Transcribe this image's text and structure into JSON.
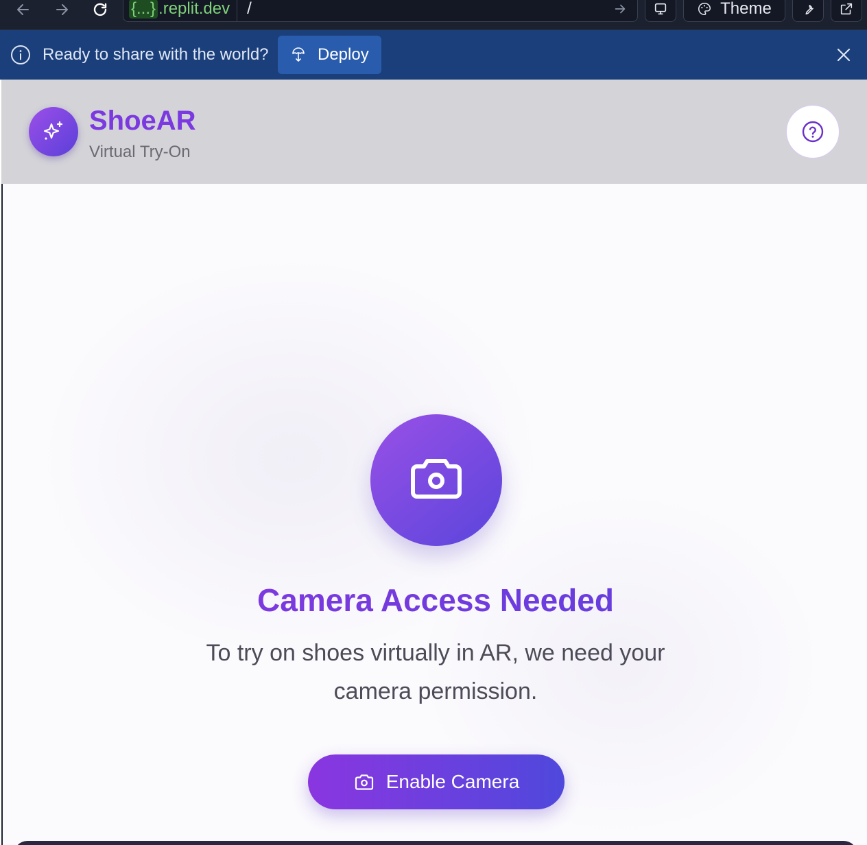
{
  "browser": {
    "url_prefix": "{...}",
    "url_domain": ".replit.dev",
    "url_path": "/",
    "theme_label": "Theme"
  },
  "banner": {
    "message": "Ready to share with the world?",
    "deploy_label": "Deploy"
  },
  "header": {
    "brand_name": "ShoeAR",
    "brand_subtitle": "Virtual Try-On"
  },
  "main": {
    "headline": "Camera Access Needed",
    "description": "To try on shoes virtually in AR, we need your camera permission.",
    "enable_label": "Enable Camera"
  },
  "colors": {
    "accent": "#7a3ae0",
    "banner_bg": "#1b3f7a",
    "deploy_button": "#2a5cae"
  },
  "icons": [
    "back-arrow-icon",
    "forward-arrow-icon",
    "reload-icon",
    "go-arrow-icon",
    "monitor-icon",
    "palette-icon",
    "wrench-icon",
    "external-link-icon",
    "info-icon",
    "deploy-icon",
    "close-icon",
    "sparkles-icon",
    "help-icon",
    "camera-icon"
  ]
}
